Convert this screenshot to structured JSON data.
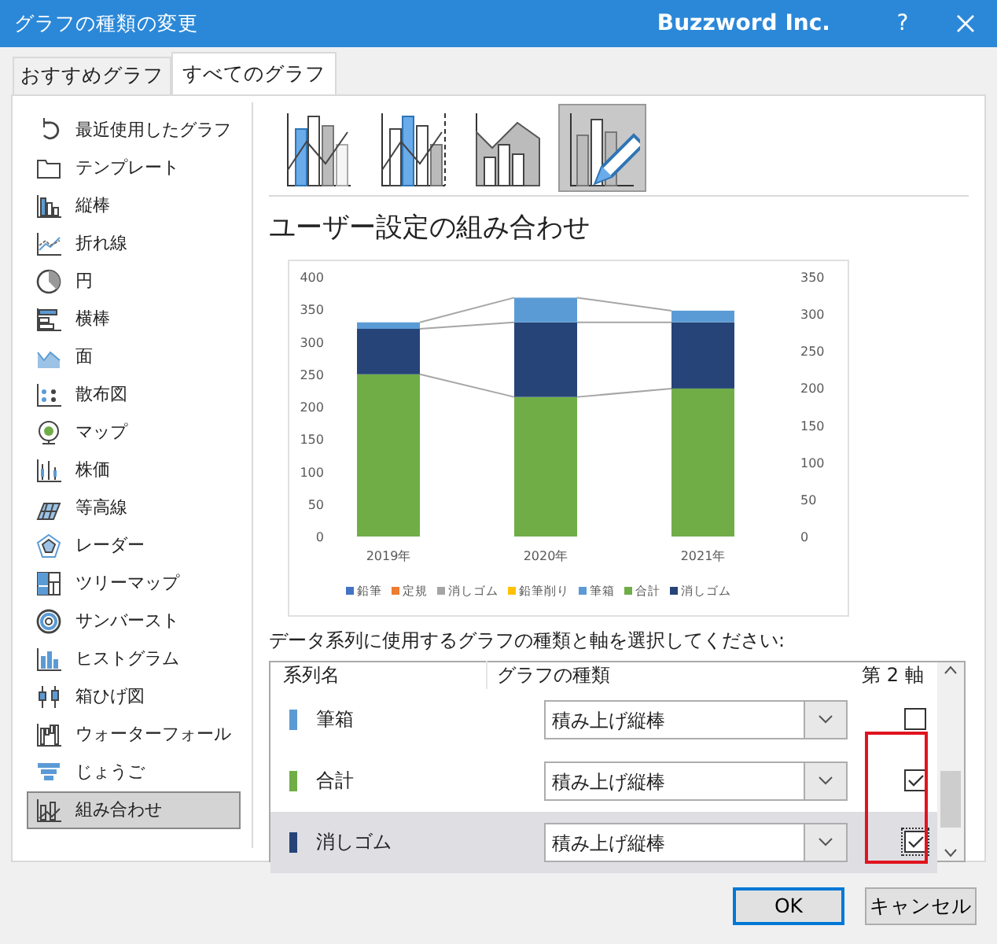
{
  "window": {
    "title": "グラフの種類の変更",
    "brand": "Buzzword Inc.",
    "help": "?"
  },
  "tabs": [
    {
      "label": "おすすめグラフ",
      "selected": false
    },
    {
      "label": "すべてのグラフ",
      "selected": true
    }
  ],
  "chart_types": [
    {
      "label": "最近使用したグラフ",
      "selected": false
    },
    {
      "label": "テンプレート",
      "selected": false
    },
    {
      "label": "縦棒",
      "selected": false
    },
    {
      "label": "折れ線",
      "selected": false
    },
    {
      "label": "円",
      "selected": false
    },
    {
      "label": "横棒",
      "selected": false
    },
    {
      "label": "面",
      "selected": false
    },
    {
      "label": "散布図",
      "selected": false
    },
    {
      "label": "マップ",
      "selected": false
    },
    {
      "label": "株価",
      "selected": false
    },
    {
      "label": "等高線",
      "selected": false
    },
    {
      "label": "レーダー",
      "selected": false
    },
    {
      "label": "ツリーマップ",
      "selected": false
    },
    {
      "label": "サンバースト",
      "selected": false
    },
    {
      "label": "ヒストグラム",
      "selected": false
    },
    {
      "label": "箱ひげ図",
      "selected": false
    },
    {
      "label": "ウォーターフォール",
      "selected": false
    },
    {
      "label": "じょうご",
      "selected": false
    },
    {
      "label": "組み合わせ",
      "selected": true
    }
  ],
  "subtypes": [
    {
      "selected": false
    },
    {
      "selected": false
    },
    {
      "selected": false
    },
    {
      "selected": true
    }
  ],
  "heading": "ユーザー設定の組み合わせ",
  "chart": {
    "chart_data": {
      "type": "bar",
      "stacked": true,
      "categories": [
        "2019年",
        "2020年",
        "2021年"
      ],
      "ylim": [
        0,
        400
      ],
      "y2lim": [
        0,
        350
      ],
      "legend": true,
      "yticks": [
        0,
        50,
        100,
        150,
        200,
        250,
        300,
        350,
        400
      ],
      "y2ticks": [
        0,
        50,
        100,
        150,
        200,
        250,
        300,
        350
      ],
      "series": [
        {
          "name": "鉛筆",
          "color": "#4472c4",
          "values": [
            null,
            null,
            null
          ]
        },
        {
          "name": "定規",
          "color": "#ed7d31",
          "values": [
            null,
            null,
            null
          ]
        },
        {
          "name": "消しゴム",
          "color": "#a5a5a5",
          "values": [
            null,
            null,
            null
          ]
        },
        {
          "name": "鉛筆削り",
          "color": "#ffc000",
          "values": [
            null,
            null,
            null
          ]
        },
        {
          "name": "筆箱",
          "color": "#5b9bd5",
          "values": [
            10,
            38,
            18
          ]
        },
        {
          "name": "合計",
          "color": "#70ad47",
          "values": [
            250,
            215,
            228
          ]
        },
        {
          "name": "消しゴム",
          "color": "#264478",
          "values": [
            70,
            115,
            102
          ]
        }
      ]
    }
  },
  "series_prompt": "データ系列に使用するグラフの種類と軸を選択してください:",
  "series_table": {
    "columns": [
      "系列名",
      "グラフの種類",
      "第 2 軸"
    ],
    "rows": [
      {
        "name": "筆箱",
        "color": "#5b9bd5",
        "chart_type": "積み上げ縦棒",
        "secondary_axis": false,
        "selected": false
      },
      {
        "name": "合計",
        "color": "#70ad47",
        "chart_type": "積み上げ縦棒",
        "secondary_axis": true,
        "selected": false
      },
      {
        "name": "消しゴム",
        "color": "#264478",
        "chart_type": "積み上げ縦棒",
        "secondary_axis": true,
        "selected": true
      }
    ]
  },
  "buttons": [
    {
      "label": "OK",
      "default": true
    },
    {
      "label": "キャンセル",
      "default": false
    }
  ]
}
